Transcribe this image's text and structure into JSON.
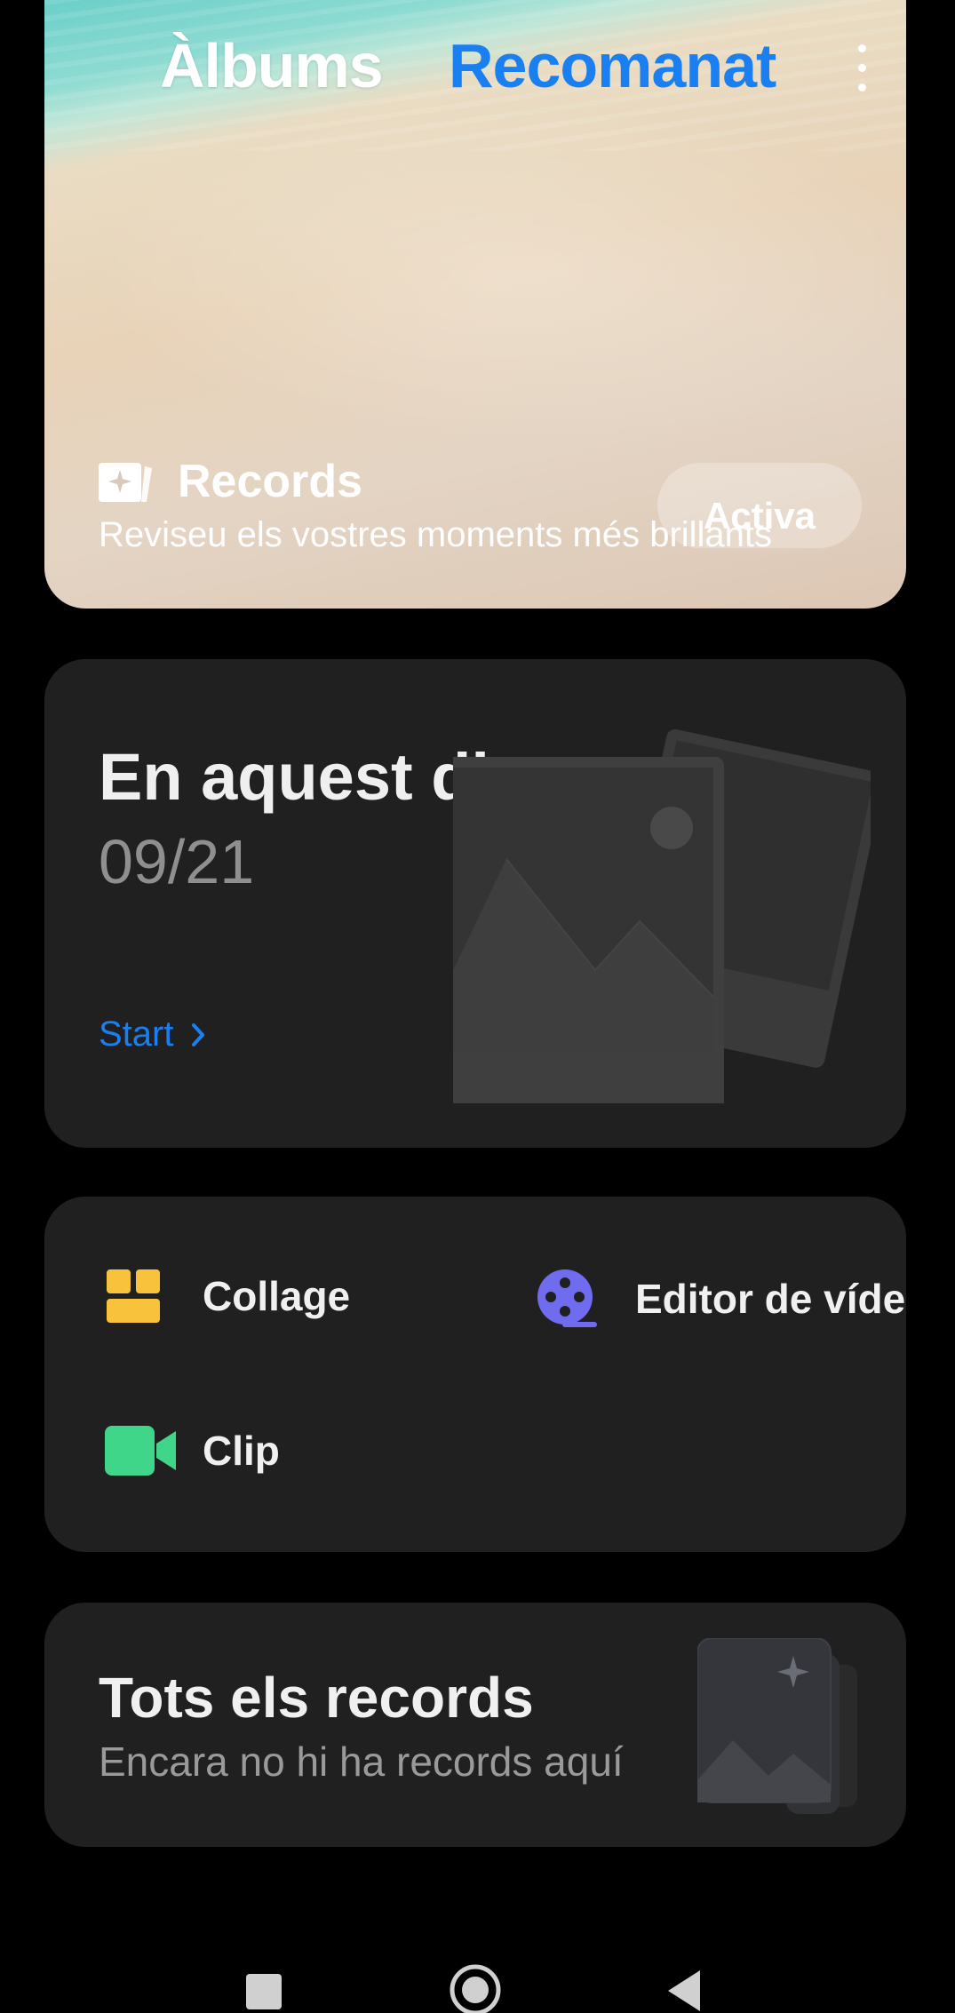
{
  "header": {
    "tabs": [
      {
        "label": "Àlbums",
        "active": false
      },
      {
        "label": "Recomanat",
        "active": true
      }
    ],
    "more_icon": "more-vertical-icon"
  },
  "records_banner": {
    "icon": "memories-icon",
    "title": "Records",
    "subtitle": "Reviseu els vostres moments més brillants",
    "button_label": "Activa"
  },
  "this_day": {
    "title": "En aquest dia",
    "date": "09/21",
    "action_label": "Start",
    "action_icon": "chevron-right-icon"
  },
  "tools": [
    {
      "label": "Collage",
      "icon": "collage-icon",
      "color": "#f9c23c"
    },
    {
      "label": "Editor de vídeo",
      "icon": "video-reel-icon",
      "color": "#6f6cf0"
    },
    {
      "label": "Clip",
      "icon": "video-camera-icon",
      "color": "#3fd68a"
    }
  ],
  "all_memories": {
    "title": "Tots els records",
    "subtitle": "Encara no hi ha records aquí"
  },
  "nav_bar": {
    "icons": [
      "recents-square-icon",
      "home-circle-icon",
      "back-triangle-icon"
    ]
  },
  "colors": {
    "accent": "#1a7ff0",
    "card_bg": "#202020",
    "background": "#000000"
  }
}
